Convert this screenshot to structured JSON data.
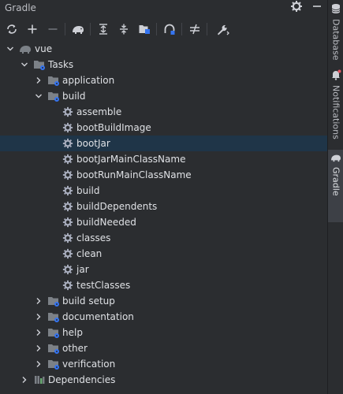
{
  "panel": {
    "title": "Gradle"
  },
  "toolbar": {
    "buttons": [
      "reload-icon",
      "add-icon",
      "remove-icon",
      "elephant-icon",
      "expand-all-icon",
      "collapse-all-icon",
      "tasks-view-icon",
      "offline-icon",
      "toggle-icon",
      "settings-wrench-icon"
    ]
  },
  "tree": {
    "root": "vue",
    "tasks": "Tasks",
    "groups": {
      "application": "application",
      "build": "build",
      "build_setup": "build setup",
      "documentation": "documentation",
      "help": "help",
      "other": "other",
      "verification": "verification"
    },
    "build_tasks": [
      "assemble",
      "bootBuildImage",
      "bootJar",
      "bootJarMainClassName",
      "bootRunMainClassName",
      "build",
      "buildDependents",
      "buildNeeded",
      "classes",
      "clean",
      "jar",
      "testClasses"
    ],
    "dependencies": "Dependencies",
    "selected": "bootJar"
  },
  "sidebar": {
    "tabs": [
      {
        "label": "Database",
        "icon": "database-icon"
      },
      {
        "label": "Notifications",
        "icon": "bell-icon"
      },
      {
        "label": "Gradle",
        "icon": "elephant-icon"
      }
    ]
  },
  "colors": {
    "background": "#2b2d30",
    "selection": "#1f3548",
    "text": "#dfe1e5",
    "icon": "#ced0d6",
    "folder": "#7c8187",
    "gear_badge": "#3574f0"
  }
}
